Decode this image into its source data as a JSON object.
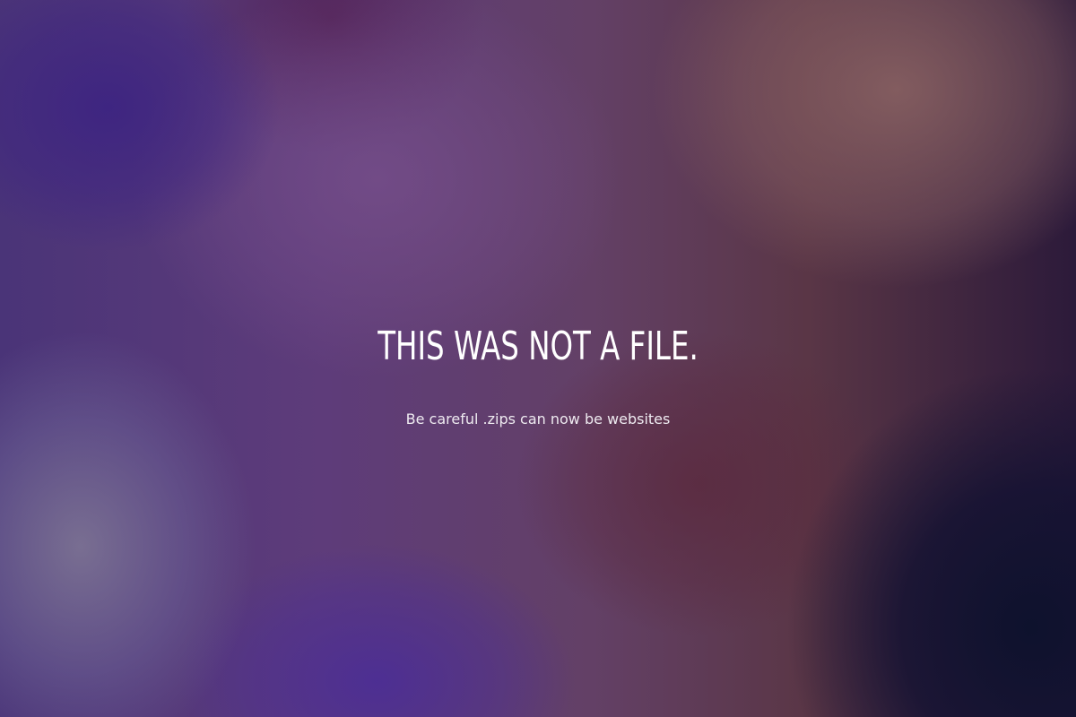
{
  "main": {
    "headline": "THIS WAS NOT A FILE.",
    "subtitle": "Be careful .zips can now be websites"
  },
  "colors": {
    "text": "#ffffff",
    "background_left": "#4a3478",
    "background_right": "#2c1a3a"
  }
}
